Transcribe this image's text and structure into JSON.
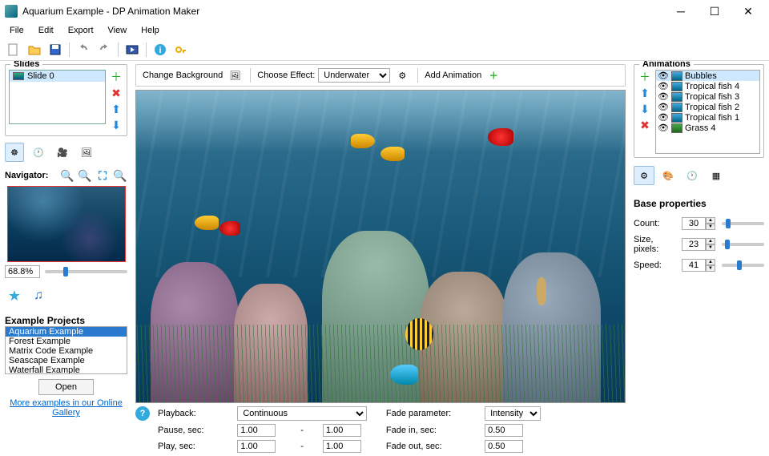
{
  "title": "Aquarium Example - DP Animation Maker",
  "menu": [
    "File",
    "Edit",
    "Export",
    "View",
    "Help"
  ],
  "toolbar_icons": [
    "new",
    "open",
    "save",
    "undo",
    "redo",
    "play",
    "info",
    "key"
  ],
  "slides": {
    "title": "Slides",
    "items": [
      {
        "label": "Slide 0",
        "selected": true
      }
    ]
  },
  "navigator": {
    "label": "Navigator:",
    "zoom": "68.8%"
  },
  "examples": {
    "title": "Example Projects",
    "items": [
      {
        "label": "Aquarium Example",
        "selected": true
      },
      {
        "label": "Forest Example"
      },
      {
        "label": "Matrix Code Example"
      },
      {
        "label": "Seascape Example"
      },
      {
        "label": "Waterfall Example"
      }
    ],
    "open_label": "Open",
    "gallery_link": "More examples in our Online Gallery"
  },
  "canvas_toolbar": {
    "change_bg": "Change Background",
    "choose_effect": "Choose Effect:",
    "effect_value": "Underwater",
    "add_animation": "Add Animation"
  },
  "playback": {
    "label": "Playback:",
    "mode": "Continuous",
    "pause_label": "Pause, sec:",
    "pause_min": "1.00",
    "pause_max": "1.00",
    "play_label": "Play, sec:",
    "play_min": "1.00",
    "play_max": "1.00",
    "fade_param_label": "Fade parameter:",
    "fade_param_value": "Intensity",
    "fade_in_label": "Fade in, sec:",
    "fade_in_value": "0.50",
    "fade_out_label": "Fade out, sec:",
    "fade_out_value": "0.50",
    "dash": "-"
  },
  "animations": {
    "title": "Animations",
    "items": [
      {
        "label": "Bubbles",
        "selected": true
      },
      {
        "label": "Tropical fish 4"
      },
      {
        "label": "Tropical fish 3"
      },
      {
        "label": "Tropical fish 2"
      },
      {
        "label": "Tropical fish 1"
      },
      {
        "label": "Grass 4"
      }
    ]
  },
  "properties": {
    "title": "Base properties",
    "rows": [
      {
        "label": "Count:",
        "value": "30",
        "pos": 10
      },
      {
        "label": "Size, pixels:",
        "value": "23",
        "pos": 8
      },
      {
        "label": "Speed:",
        "value": "41",
        "pos": 35
      }
    ]
  }
}
